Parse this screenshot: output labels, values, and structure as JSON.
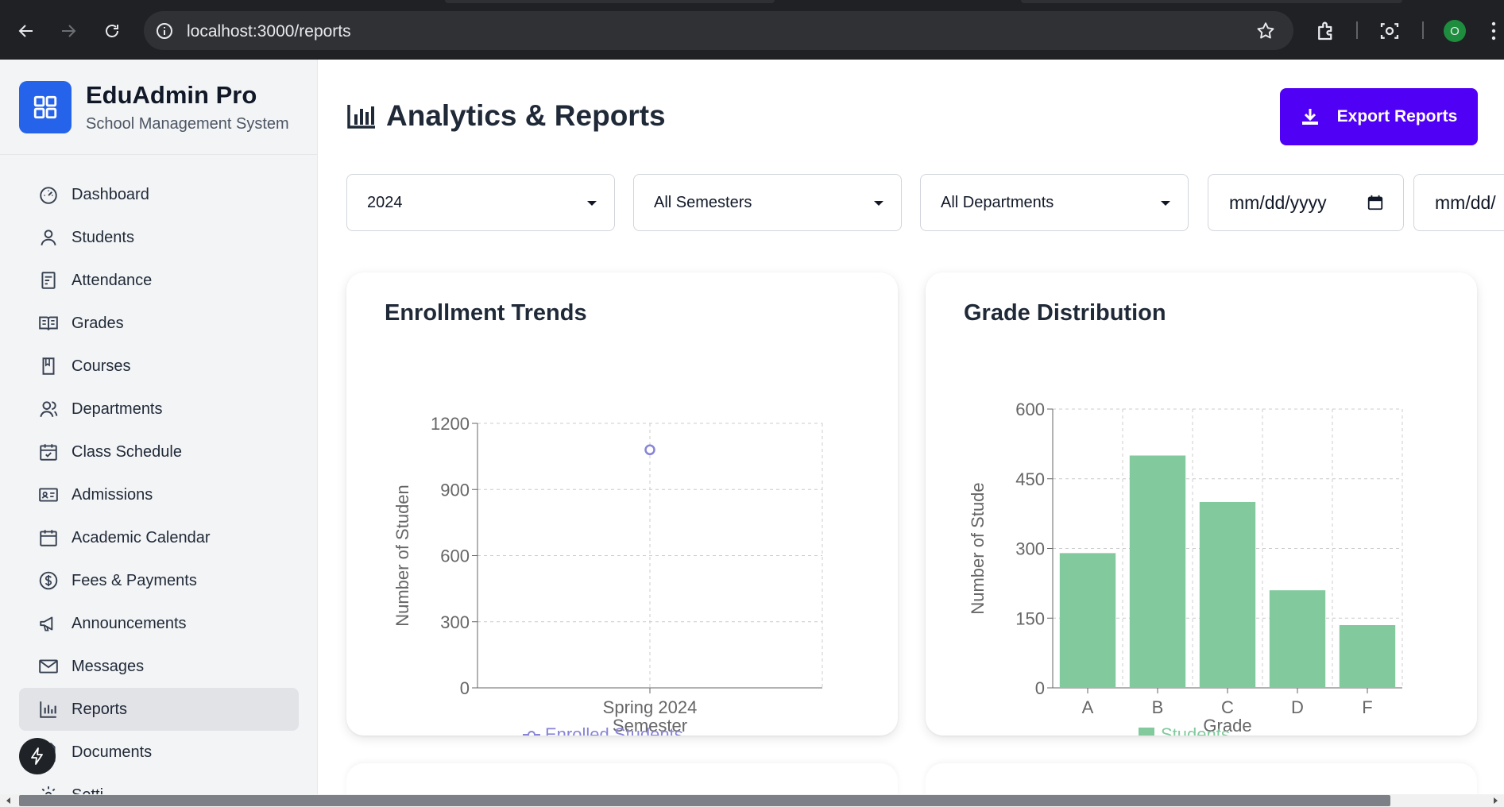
{
  "browser": {
    "url": "localhost:3000/reports",
    "profile_initial": "O"
  },
  "sidebar": {
    "brand_name": "EduAdmin Pro",
    "brand_subtitle": "School Management System",
    "items": [
      {
        "label": "Dashboard",
        "icon": "gauge-icon"
      },
      {
        "label": "Students",
        "icon": "user-icon"
      },
      {
        "label": "Attendance",
        "icon": "clipboard-icon"
      },
      {
        "label": "Grades",
        "icon": "book-open-icon"
      },
      {
        "label": "Courses",
        "icon": "book-icon"
      },
      {
        "label": "Departments",
        "icon": "users-icon"
      },
      {
        "label": "Class Schedule",
        "icon": "calendar-check-icon"
      },
      {
        "label": "Admissions",
        "icon": "id-card-icon"
      },
      {
        "label": "Academic Calendar",
        "icon": "calendar-icon"
      },
      {
        "label": "Fees & Payments",
        "icon": "dollar-circle-icon"
      },
      {
        "label": "Announcements",
        "icon": "megaphone-icon"
      },
      {
        "label": "Messages",
        "icon": "mail-icon"
      },
      {
        "label": "Reports",
        "icon": "bar-chart-icon",
        "active": true
      },
      {
        "label": "Documents",
        "icon": "document-icon"
      },
      {
        "label": "Setti",
        "icon": "gear-icon"
      }
    ]
  },
  "header": {
    "title": "Analytics & Reports",
    "export_label": "Export Reports"
  },
  "filters": {
    "year": "2024",
    "semester": "All Semesters",
    "department": "All Departments",
    "start_date_placeholder": "mm/dd/yyyy",
    "end_date_placeholder": "mm/dd/"
  },
  "colors": {
    "accent": "#4f00f5",
    "brand": "#2563eb",
    "line_series": "#8884d8",
    "bar_series": "#82ca9d"
  },
  "chart_data": [
    {
      "type": "line",
      "title": "Enrollment Trends",
      "xlabel": "Semester",
      "ylabel": "Number of Studen",
      "categories": [
        "Spring 2024"
      ],
      "series": [
        {
          "name": "Enrolled Students",
          "values": [
            1080
          ]
        }
      ],
      "ylim": [
        0,
        1200
      ],
      "yticks": [
        0,
        300,
        600,
        900,
        1200
      ],
      "grid": true,
      "legend": "bottom"
    },
    {
      "type": "bar",
      "title": "Grade Distribution",
      "xlabel": "Grade",
      "ylabel": "Number of Stude",
      "categories": [
        "A",
        "B",
        "C",
        "D",
        "F"
      ],
      "series": [
        {
          "name": "Students",
          "values": [
            290,
            500,
            400,
            210,
            135
          ]
        }
      ],
      "ylim": [
        0,
        600
      ],
      "yticks": [
        0,
        150,
        300,
        450,
        600
      ],
      "grid": true,
      "legend": "bottom"
    }
  ]
}
